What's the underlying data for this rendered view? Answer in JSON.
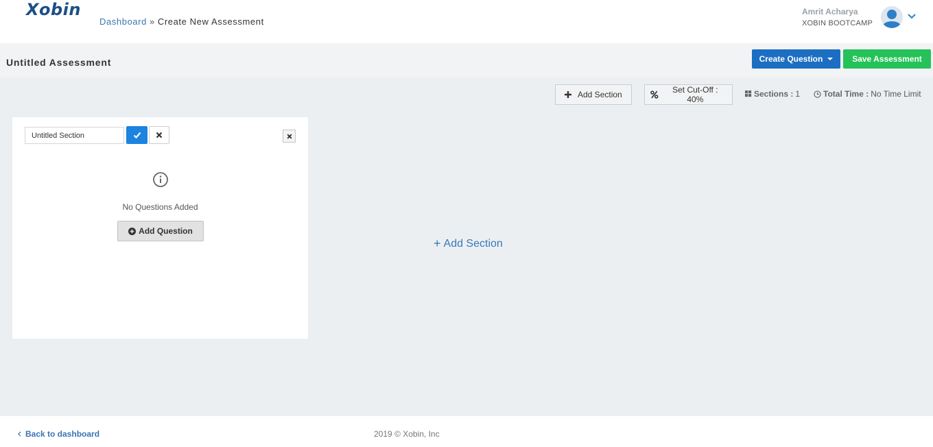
{
  "header": {
    "logo_text": "Xobin",
    "breadcrumb": {
      "link": "Dashboard",
      "separator": "»",
      "current": "Create New Assessment"
    },
    "user": {
      "name": "Amrit Acharya",
      "org": "XOBIN BOOTCAMP"
    }
  },
  "titlebar": {
    "title": "Untitled Assessment",
    "create_question_label": "Create Question",
    "save_assessment_label": "Save Assessment"
  },
  "toolbar": {
    "add_section_label": "Add Section",
    "cutoff_label": "Set Cut-Off : 40%",
    "sections_label": "Sections :",
    "sections_count": "1",
    "total_time_label": "Total Time :",
    "total_time_value": "No Time Limit"
  },
  "section_card": {
    "name_value": "Untitled Section",
    "empty_message": "No Questions Added",
    "add_question_label": "Add Question"
  },
  "main": {
    "add_section_link": "Add Section"
  },
  "footer": {
    "back_label": "Back to dashboard",
    "copyright": "2019 © Xobin, Inc"
  },
  "colors": {
    "brand_blue": "#1d4f86",
    "link_blue": "#3a74b0",
    "primary_button": "#1b6ec2",
    "success_button": "#24c258",
    "check_button": "#1b83e0",
    "main_background": "#eceff2"
  },
  "icons": {
    "avatar": "user-avatar-icon",
    "user_menu": "chevron-down-icon",
    "add": "plus-icon",
    "cutoff": "percent-icon",
    "sections": "grid-icon",
    "time": "clock-icon",
    "confirm": "check-icon",
    "cancel": "close-icon",
    "remove_section": "close-icon",
    "empty_state": "info-icon",
    "add_question": "plus-circle-icon",
    "back": "chevron-left-icon"
  }
}
